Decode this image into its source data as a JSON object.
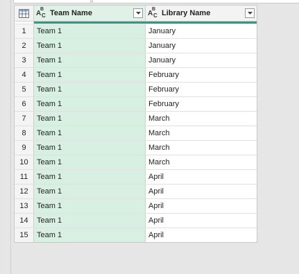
{
  "columns": [
    {
      "name": "Team Name",
      "type_icon": "text-type-icon"
    },
    {
      "name": "Library Name",
      "type_icon": "text-type-icon"
    }
  ],
  "type_icon_letters": {
    "a": "A",
    "b": "B",
    "c": "C"
  },
  "accent_color": "#1fa386",
  "selected_column_color": "#d8f0e2",
  "rows": [
    {
      "n": "1",
      "team": "Team 1",
      "library": "January"
    },
    {
      "n": "2",
      "team": "Team 1",
      "library": "January"
    },
    {
      "n": "3",
      "team": "Team 1",
      "library": "January"
    },
    {
      "n": "4",
      "team": "Team 1",
      "library": "February"
    },
    {
      "n": "5",
      "team": "Team 1",
      "library": "February"
    },
    {
      "n": "6",
      "team": "Team 1",
      "library": "February"
    },
    {
      "n": "7",
      "team": "Team 1",
      "library": "March"
    },
    {
      "n": "8",
      "team": "Team 1",
      "library": "March"
    },
    {
      "n": "9",
      "team": "Team 1",
      "library": "March"
    },
    {
      "n": "10",
      "team": "Team 1",
      "library": "March"
    },
    {
      "n": "11",
      "team": "Team 1",
      "library": "April"
    },
    {
      "n": "12",
      "team": "Team 1",
      "library": "April"
    },
    {
      "n": "13",
      "team": "Team 1",
      "library": "April"
    },
    {
      "n": "14",
      "team": "Team 1",
      "library": "April"
    },
    {
      "n": "15",
      "team": "Team 1",
      "library": "April"
    }
  ]
}
